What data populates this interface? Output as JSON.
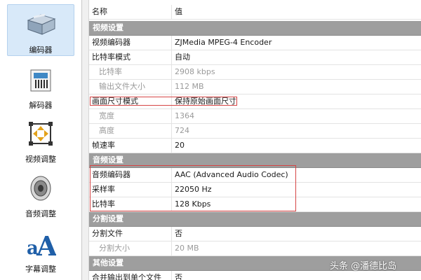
{
  "sidebar": {
    "items": [
      {
        "label": "编码器",
        "icon": "encoder-icon",
        "active": true
      },
      {
        "label": "解码器",
        "icon": "decoder-icon",
        "active": false
      },
      {
        "label": "视频调整",
        "icon": "video-adjust-icon",
        "active": false
      },
      {
        "label": "音频调整",
        "icon": "speaker-icon",
        "active": false
      },
      {
        "label": "字幕调整",
        "icon": "subtitle-icon",
        "active": false
      }
    ]
  },
  "grid": {
    "columns": {
      "name": "名称",
      "value": "值"
    },
    "video_section": "视频设置",
    "video_encoder": {
      "name": "视频编码器",
      "value": "ZJMedia MPEG-4 Encoder"
    },
    "bitrate_mode": {
      "name": "比特率模式",
      "value": "自动"
    },
    "bitrate": {
      "name": "比特率",
      "value": "2908 kbps"
    },
    "output_size": {
      "name": "输出文件大小",
      "value": "112 MB"
    },
    "frame_size_mode": {
      "name": "画面尺寸模式",
      "value": "保持原始画面尺寸"
    },
    "width": {
      "name": "宽度",
      "value": "1364"
    },
    "height": {
      "name": "高度",
      "value": "724"
    },
    "frame_rate": {
      "name": "帧速率",
      "value": "20"
    },
    "audio_section": "音频设置",
    "audio_encoder": {
      "name": "音频编码器",
      "value": "AAC (Advanced Audio Codec)"
    },
    "sample_rate": {
      "name": "采样率",
      "value": "22050 Hz"
    },
    "audio_bitrate": {
      "name": "比特率",
      "value": "128 Kbps"
    },
    "split_section": "分割设置",
    "split_file": {
      "name": "分割文件",
      "value": "否"
    },
    "split_size": {
      "name": "分割大小",
      "value": "20 MB"
    },
    "other_section": "其他设置",
    "merge_output": {
      "name": "合并输出到单个文件",
      "value": "否"
    }
  },
  "watermark": "头条 @潘德比岛",
  "colors": {
    "highlight": "#d64545",
    "section_header": "#9e9e9e",
    "active_nav": "#d8e9f9"
  }
}
